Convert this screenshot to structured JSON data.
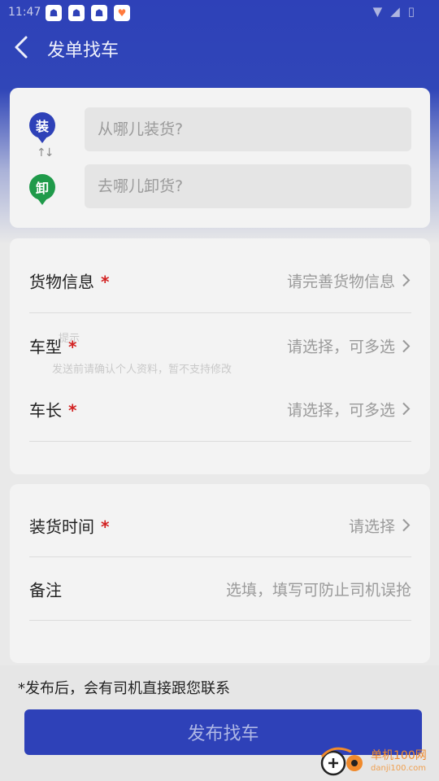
{
  "status_bar": {
    "time": "11:47",
    "apps": [
      "app-icon-1",
      "app-icon-2",
      "app-icon-3",
      "heart-app-icon"
    ]
  },
  "header": {
    "title": "发单找车"
  },
  "route": {
    "load_badge": "装",
    "unload_badge": "卸",
    "load_placeholder": "从哪儿装货?",
    "unload_placeholder": "去哪儿卸货?"
  },
  "info": {
    "cargo": {
      "label": "货物信息",
      "value": "请完善货物信息"
    },
    "vehicle_type": {
      "label": "车型",
      "value": "请选择，可多选"
    },
    "vehicle_length": {
      "label": "车长",
      "value": "请选择，可多选"
    },
    "ghost_title": "提示",
    "ghost_text": "发送前请确认个人资料，暂不支持修改"
  },
  "schedule": {
    "load_time": {
      "label": "装货时间",
      "value": "请选择"
    },
    "note": {
      "label": "备注",
      "placeholder": "选填，填写可防止司机误抢"
    }
  },
  "footer": {
    "notice": "*发布后，会有司机直接跟您联系",
    "publish_label": "发布找车",
    "watermark_main": "单机100网",
    "watermark_sub": "danji100.com"
  },
  "colors": {
    "brand_blue": "#2e41b8",
    "unload_green": "#1f9a4a",
    "required_red": "#d21f1f"
  }
}
